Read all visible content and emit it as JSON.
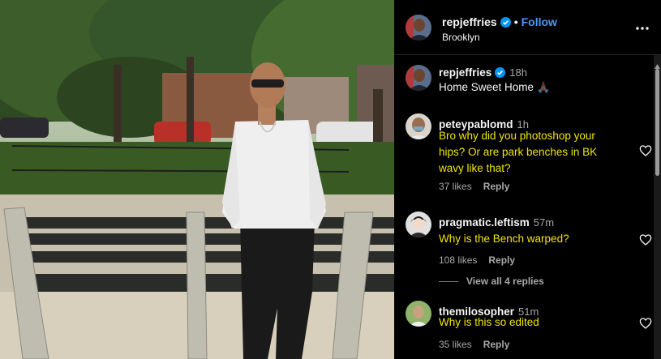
{
  "post": {
    "author": "repjeffries",
    "location": "Brooklyn",
    "follow_label": "Follow",
    "separator": "•"
  },
  "caption": {
    "user": "repjeffries",
    "time": "18h",
    "text": "Home Sweet Home 🙏🏿"
  },
  "comments": [
    {
      "user": "peteypablomd",
      "time": "1h",
      "text": "Bro why did you photoshop your hips? Or are park benches in BK wavy like that?",
      "likes": "37 likes",
      "reply": "Reply"
    },
    {
      "user": "pragmatic.leftism",
      "time": "57m",
      "text": "Why is the Bench warped?",
      "likes": "108 likes",
      "reply": "Reply"
    },
    {
      "user": "themilosopher",
      "time": "51m",
      "text": "Why is this so edited",
      "likes": "35 likes",
      "reply": "Reply"
    }
  ],
  "view_replies": "View all 4 replies",
  "icons": {
    "verified": "verified-badge-icon",
    "more": "more-options-icon",
    "like": "heart-icon"
  },
  "colors": {
    "background": "#000000",
    "accent": "#4a98f5",
    "comment_highlight": "#f1e400",
    "muted": "#a8a8a8"
  }
}
